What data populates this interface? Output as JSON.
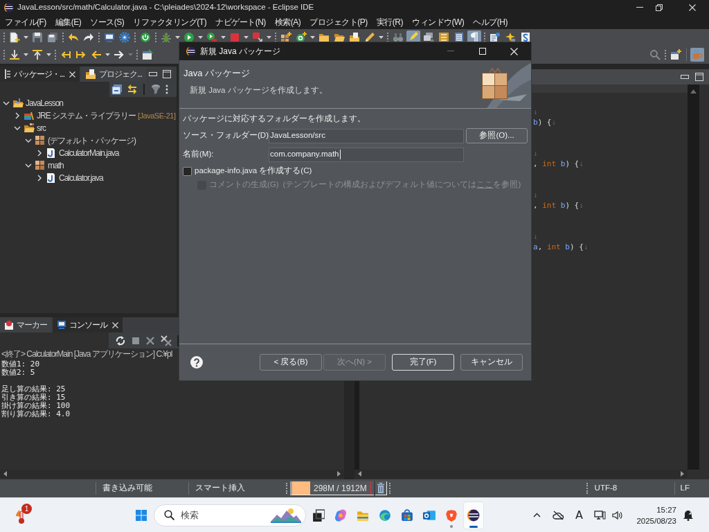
{
  "window": {
    "title": "JavaLesson/src/math/Calculator.java - C:\\pleiades\\2024-12\\workspace - Eclipse IDE"
  },
  "menu": [
    "ファイル(F)",
    "編集(E)",
    "ソース(S)",
    "リファクタリング(T)",
    "ナビゲート(N)",
    "検索(A)",
    "プロジェクト(P)",
    "実行(R)",
    "ウィンドウ(W)",
    "ヘルプ(H)"
  ],
  "toolbar": {
    "mark_occurrences": true,
    "show_whitespace": true,
    "java_perspective": true
  },
  "package_explorer": {
    "tabs": [
      {
        "label": "パッケージ・...",
        "selected": true
      },
      {
        "label": "プロジェク...",
        "selected": false
      }
    ],
    "tree": [
      {
        "label": "JavaLesson",
        "kind": "project",
        "expanded": true,
        "children": [
          {
            "label": "JRE システム・ライブラリー",
            "suffix": "[JavaSE-21]",
            "kind": "library",
            "expanded": false
          },
          {
            "label": "src",
            "kind": "source-folder",
            "expanded": true,
            "children": [
              {
                "label": "(デフォルト・パッケージ)",
                "kind": "package",
                "expanded": true,
                "children": [
                  {
                    "label": "CalculatorMain.java",
                    "kind": "java-file",
                    "expanded": false
                  }
                ]
              },
              {
                "label": "math",
                "kind": "package",
                "expanded": true,
                "children": [
                  {
                    "label": "Calculator.java",
                    "kind": "java-file",
                    "expanded": false
                  }
                ]
              }
            ]
          }
        ]
      }
    ]
  },
  "editor": {
    "blocks": [
      [
        [
          {
            "text": "↓",
            "kind": "eol"
          }
        ],
        [
          {
            "text": "b",
            "kind": "param"
          },
          {
            "text": ") {",
            "kind": "plain"
          },
          {
            "text": "↓",
            "kind": "eol"
          }
        ]
      ],
      [
        [
          {
            "text": "↓",
            "kind": "eol"
          }
        ],
        [
          {
            "text": ", ",
            "kind": "plain"
          },
          {
            "text": "int",
            "kind": "keyword"
          },
          {
            "text": " b",
            "kind": "param"
          },
          {
            "text": ") {",
            "kind": "plain"
          },
          {
            "text": "↓",
            "kind": "eol"
          }
        ]
      ],
      [
        [
          {
            "text": "↓",
            "kind": "eol"
          }
        ],
        [
          {
            "text": ", ",
            "kind": "plain"
          },
          {
            "text": "int",
            "kind": "keyword"
          },
          {
            "text": " b",
            "kind": "param"
          },
          {
            "text": ") {",
            "kind": "plain"
          },
          {
            "text": "↓",
            "kind": "eol"
          }
        ]
      ],
      [
        [
          {
            "text": "↓",
            "kind": "eol"
          }
        ],
        [
          {
            "text": "a",
            "kind": "param"
          },
          {
            "text": ", ",
            "kind": "plain"
          },
          {
            "text": "int",
            "kind": "keyword"
          },
          {
            "text": " b",
            "kind": "param"
          },
          {
            "text": ") {",
            "kind": "plain"
          },
          {
            "text": "↓",
            "kind": "eol"
          }
        ]
      ]
    ]
  },
  "console": {
    "tabs": [
      {
        "label": "マーカー",
        "selected": false
      },
      {
        "label": "コンソール",
        "selected": true
      }
    ],
    "header": "<終了> CalculatorMain [Java アプリケーション] C:¥pl",
    "output": [
      [
        "数値1: 20",
        "数値2: 5"
      ],
      [
        "足し算の結果: 25",
        "引き算の結果: 15",
        "掛け算の結果: 100",
        "割り算の結果: 4.0"
      ]
    ]
  },
  "status_bar": {
    "fields": [
      "書き込み可能",
      "スマート挿入"
    ],
    "heap": {
      "label": "298M / 1912M",
      "level": 0.22
    },
    "encoding": "UTF-8",
    "line_delimiter": "LF"
  },
  "dialog": {
    "title": "新規 Java パッケージ",
    "heading": "Java パッケージ",
    "description": "新規 Java パッケージを作成します。",
    "intro": "パッケージに対応するフォルダーを作成します。",
    "fields": [
      {
        "label": "ソース・フォルダー(D):",
        "value": "JavaLesson/src",
        "focused": false,
        "button": "参照(O)..."
      },
      {
        "label": "名前(M):",
        "value": "com.company.math",
        "focused": true
      }
    ],
    "options": [
      {
        "label": "package-info.java を作成する(C)",
        "checked": false,
        "disabled": false,
        "children": [
          {
            "label": "コメントの生成(G)",
            "checked": false,
            "disabled": true,
            "hint": {
              "text": "(テンプレートの構成およびデフォルト値については",
              "link": "ここ",
              "after": "を参照)"
            }
          }
        ]
      }
    ],
    "buttons": [
      {
        "label": "< 戻る(B)",
        "disabled": false,
        "default": false
      },
      {
        "label": "次へ(N) >",
        "disabled": true,
        "default": false
      },
      {
        "label": "完了(F)",
        "disabled": false,
        "default": true
      },
      {
        "label": "キャンセル",
        "disabled": false,
        "default": false
      }
    ]
  },
  "taskbar": {
    "weather_badge": "1",
    "search": {
      "placeholder": "検索"
    },
    "apps": [
      {
        "running": false,
        "active": false
      },
      {
        "running": false,
        "active": false
      },
      {
        "running": false,
        "active": false
      },
      {
        "running": false,
        "active": false
      },
      {
        "running": false,
        "active": false
      },
      {
        "running": false,
        "active": false
      },
      {
        "running": true,
        "active": false
      },
      {
        "running": true,
        "active": true
      }
    ],
    "ime_mode": "A",
    "clock": {
      "time": "15:27",
      "date": "2025/08/23"
    }
  }
}
